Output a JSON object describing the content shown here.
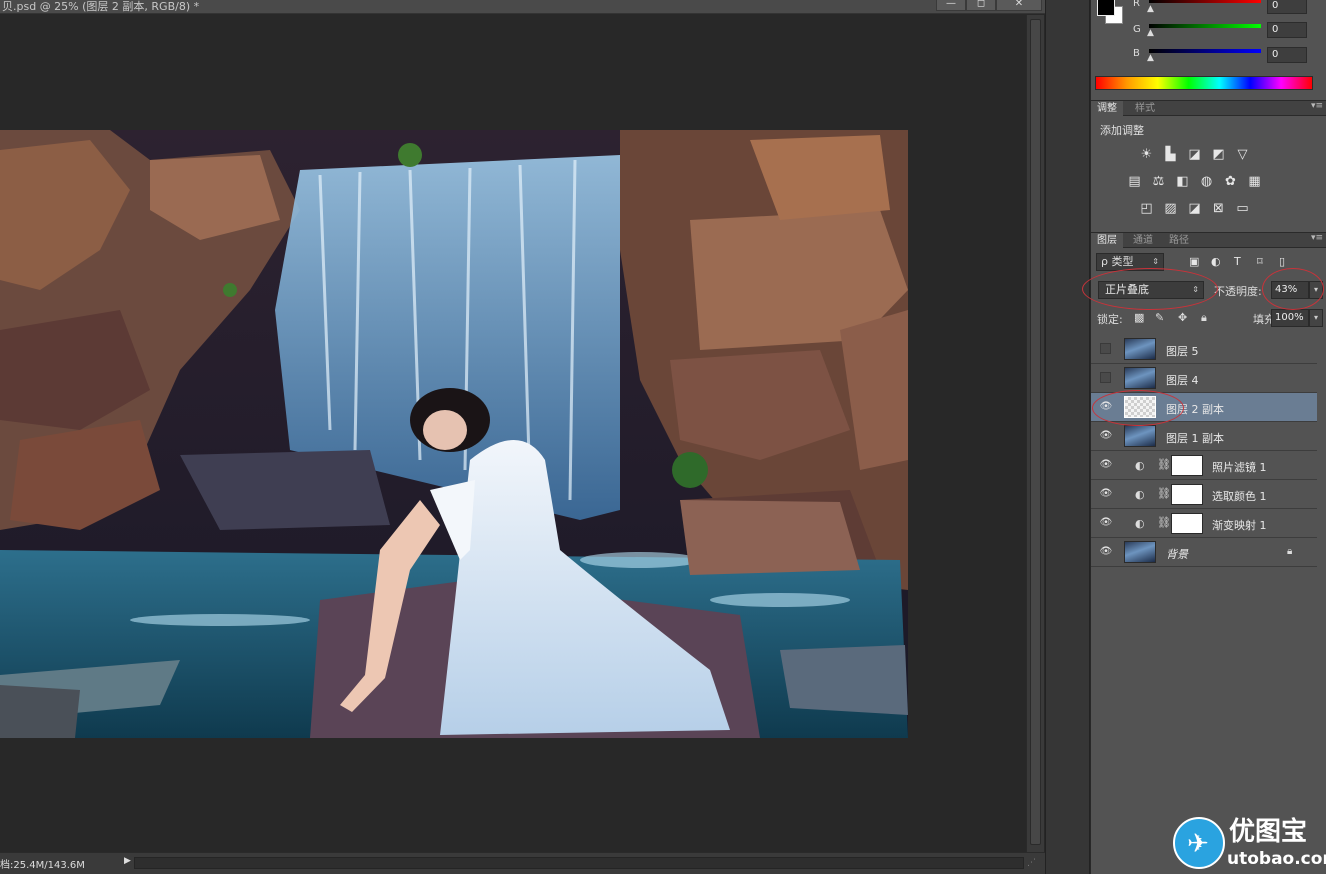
{
  "document": {
    "title": "贝.psd @ 25% (图层 2 副本, RGB/8) *",
    "window_buttons": [
      "—",
      "◻",
      "✕"
    ],
    "status": "档:25.4M/143.6M"
  },
  "color_panel": {
    "channels": [
      {
        "label": "R",
        "value": "0"
      },
      {
        "label": "G",
        "value": "0"
      },
      {
        "label": "B",
        "value": "0"
      }
    ]
  },
  "adjustments_panel": {
    "tabs": [
      "调整",
      "样式"
    ],
    "title": "添加调整"
  },
  "layers_panel": {
    "tabs": [
      "图层",
      "通道",
      "路径"
    ],
    "filter": "ρ 类型",
    "blend_mode": "正片叠底",
    "opacity_label": "不透明度:",
    "opacity": "43%",
    "lock_label": "锁定:",
    "fill_label": "填充:",
    "fill": "100%",
    "layers": [
      {
        "name": "图层 5",
        "visible": false,
        "kind": "pixel"
      },
      {
        "name": "图层 4",
        "visible": false,
        "kind": "pixel"
      },
      {
        "name": "图层 2 副本",
        "visible": true,
        "kind": "transparent",
        "selected": true
      },
      {
        "name": "图层 1 副本",
        "visible": true,
        "kind": "pixel"
      },
      {
        "name": "照片滤镜 1",
        "visible": true,
        "kind": "adjustment"
      },
      {
        "name": "选取颜色 1",
        "visible": true,
        "kind": "adjustment"
      },
      {
        "name": "渐变映射 1",
        "visible": true,
        "kind": "adjustment"
      },
      {
        "name": "背景",
        "visible": true,
        "kind": "background",
        "locked": true
      }
    ]
  },
  "watermark": {
    "cn": "优图宝",
    "en": "utobao.com"
  },
  "colors": {
    "panel_bg": "#535353",
    "selected_layer": "#6a7d93",
    "annotation_red": "#c8333a"
  }
}
